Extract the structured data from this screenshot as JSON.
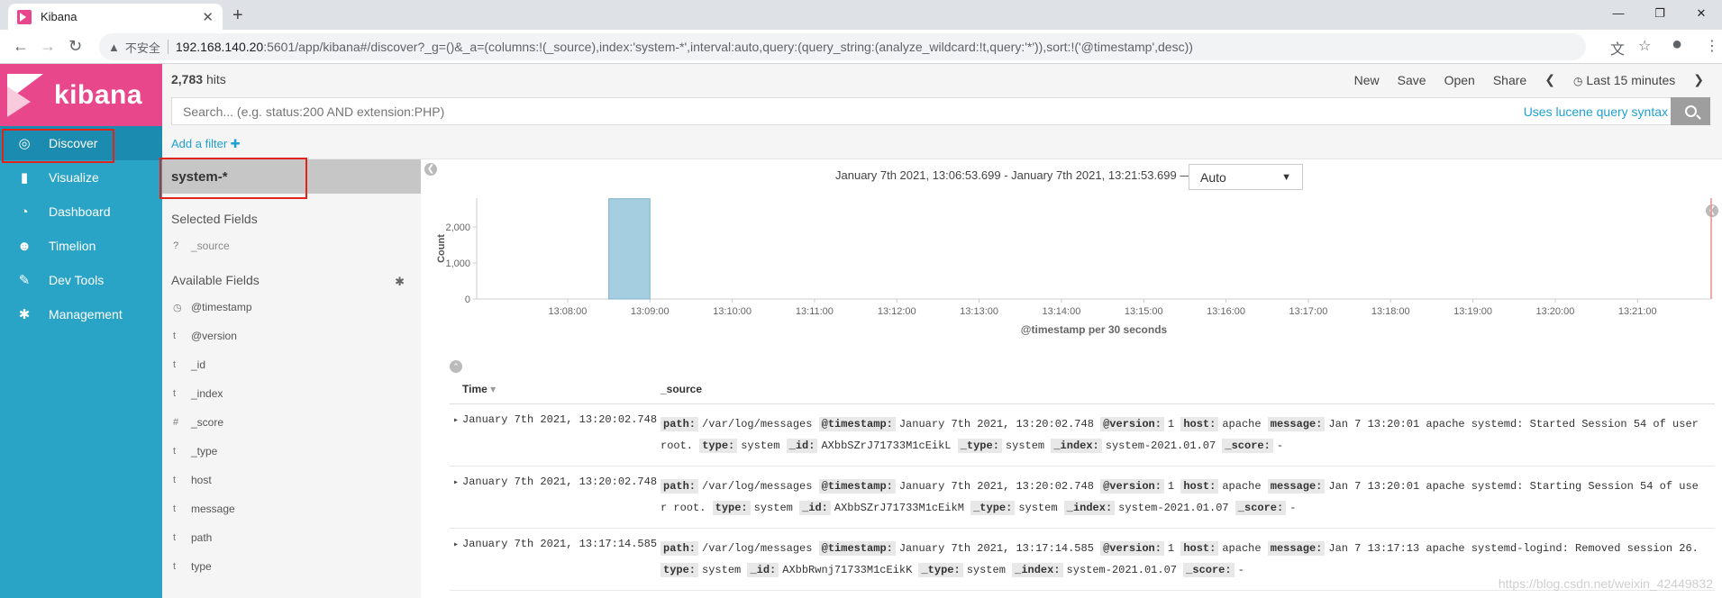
{
  "browser": {
    "tab_title": "Kibana",
    "tab_close": "✕",
    "new_tab": "+",
    "win_minimize": "—",
    "win_maximize": "❐",
    "win_close": "✕",
    "nav_back": "←",
    "nav_forward": "→",
    "nav_reload": "↻",
    "security_warning": "▲",
    "insecure_label": "不安全",
    "url_host": "192.168.140.20",
    "url_rest": ":5601/app/kibana#/discover?_g=()&_a=(columns:!(_source),index:'system-*',interval:auto,query:(query_string:(analyze_wildcard:!t,query:'*')),sort:!('@timestamp',desc))",
    "translate_icon": "文",
    "bookmark_icon": "☆",
    "profile_icon": "●",
    "menu_icon": "⋮"
  },
  "kibana": {
    "logo_text": "kibana",
    "nav": [
      {
        "label": "Discover",
        "icon": "compass-icon",
        "glyph": "◎"
      },
      {
        "label": "Visualize",
        "icon": "bar-chart-icon",
        "glyph": "▮"
      },
      {
        "label": "Dashboard",
        "icon": "dashboard-icon",
        "glyph": "◔"
      },
      {
        "label": "Timelion",
        "icon": "timelion-icon",
        "glyph": "☻"
      },
      {
        "label": "Dev Tools",
        "icon": "wrench-icon",
        "glyph": "✎"
      },
      {
        "label": "Management",
        "icon": "gear-icon",
        "glyph": "✱"
      }
    ]
  },
  "header": {
    "hits_count": "2,783",
    "hits_label": "hits",
    "menu": {
      "new": "New",
      "save": "Save",
      "open": "Open",
      "share": "Share"
    },
    "prev": "❮",
    "next": "❯",
    "clock_icon": "◷",
    "time_label": "Last 15 minutes"
  },
  "search": {
    "placeholder": "Search... (e.g. status:200 AND extension:PHP)",
    "lucene_link": "Uses lucene query syntax"
  },
  "filter": {
    "add_filter": "Add a filter",
    "plus": "✚"
  },
  "sidebar": {
    "index_pattern": "system-*",
    "selected_title": "Selected Fields",
    "selected_fields": [
      {
        "type": "?",
        "name": "_source"
      }
    ],
    "available_title": "Available Fields",
    "gear": "✱",
    "available_fields": [
      {
        "type": "◷",
        "name": "@timestamp"
      },
      {
        "type": "t",
        "name": "@version"
      },
      {
        "type": "t",
        "name": "_id"
      },
      {
        "type": "t",
        "name": "_index"
      },
      {
        "type": "#",
        "name": "_score"
      },
      {
        "type": "t",
        "name": "_type"
      },
      {
        "type": "t",
        "name": "host"
      },
      {
        "type": "t",
        "name": "message"
      },
      {
        "type": "t",
        "name": "path"
      },
      {
        "type": "t",
        "name": "type"
      }
    ]
  },
  "chart_header": {
    "time_range": "January 7th 2021, 13:06:53.699 - January 7th 2021, 13:21:53.699 —",
    "interval": "Auto",
    "collapse_left": "❮",
    "collapse_right": "❮",
    "collapse_up": "⌃"
  },
  "chart_data": {
    "type": "bar",
    "ylabel": "Count",
    "xlabel": "@timestamp per 30 seconds",
    "yticks": [
      "0",
      "1,000",
      "2,000"
    ],
    "ylim": [
      0,
      2800
    ],
    "xticks": [
      "13:08:00",
      "13:09:00",
      "13:10:00",
      "13:11:00",
      "13:12:00",
      "13:13:00",
      "13:14:00",
      "13:15:00",
      "13:16:00",
      "13:17:00",
      "13:18:00",
      "13:19:00",
      "13:20:00",
      "13:21:00"
    ],
    "bars": [
      {
        "x": "13:08:30",
        "value": 2783
      }
    ],
    "bar_color": "#a5cee0",
    "now_marker_color": "#e88c8c"
  },
  "table": {
    "col_time": "Time",
    "sort_icon": "▾",
    "col_source": "_source",
    "rows": [
      {
        "time": "January 7th 2021, 13:20:02.748",
        "fields": [
          {
            "k": "path:",
            "v": "/var/log/messages"
          },
          {
            "k": "@timestamp:",
            "v": "January 7th 2021, 13:20:02.748"
          },
          {
            "k": "@version:",
            "v": "1"
          },
          {
            "k": "host:",
            "v": "apache"
          },
          {
            "k": "message:",
            "v": "Jan 7 13:20:01 apache systemd: Started Session 54 of user root."
          },
          {
            "k": "type:",
            "v": "system"
          },
          {
            "k": "_id:",
            "v": "AXbbSZrJ71733M1cEikL"
          },
          {
            "k": "_type:",
            "v": "system"
          },
          {
            "k": "_index:",
            "v": "system-2021.01.07"
          },
          {
            "k": "_score:",
            "v": "-"
          }
        ]
      },
      {
        "time": "January 7th 2021, 13:20:02.748",
        "fields": [
          {
            "k": "path:",
            "v": "/var/log/messages"
          },
          {
            "k": "@timestamp:",
            "v": "January 7th 2021, 13:20:02.748"
          },
          {
            "k": "@version:",
            "v": "1"
          },
          {
            "k": "host:",
            "v": "apache"
          },
          {
            "k": "message:",
            "v": "Jan 7 13:20:01 apache systemd: Starting Session 54 of user root."
          },
          {
            "k": "type:",
            "v": "system"
          },
          {
            "k": "_id:",
            "v": "AXbbSZrJ71733M1cEikM"
          },
          {
            "k": "_type:",
            "v": "system"
          },
          {
            "k": "_index:",
            "v": "system-2021.01.07"
          },
          {
            "k": "_score:",
            "v": "-"
          }
        ]
      },
      {
        "time": "January 7th 2021, 13:17:14.585",
        "fields": [
          {
            "k": "path:",
            "v": "/var/log/messages"
          },
          {
            "k": "@timestamp:",
            "v": "January 7th 2021, 13:17:14.585"
          },
          {
            "k": "@version:",
            "v": "1"
          },
          {
            "k": "host:",
            "v": "apache"
          },
          {
            "k": "message:",
            "v": "Jan 7 13:17:13 apache systemd-logind: Removed session 26."
          },
          {
            "k": "type:",
            "v": "system"
          },
          {
            "k": "_id:",
            "v": "AXbbRwnj71733M1cEikK"
          },
          {
            "k": "_type:",
            "v": "system"
          },
          {
            "k": "_index:",
            "v": "system-2021.01.07"
          },
          {
            "k": "_score:",
            "v": "-"
          }
        ]
      }
    ],
    "expand_icon": "▸"
  },
  "watermark": "https://blog.csdn.net/weixin_42449832"
}
